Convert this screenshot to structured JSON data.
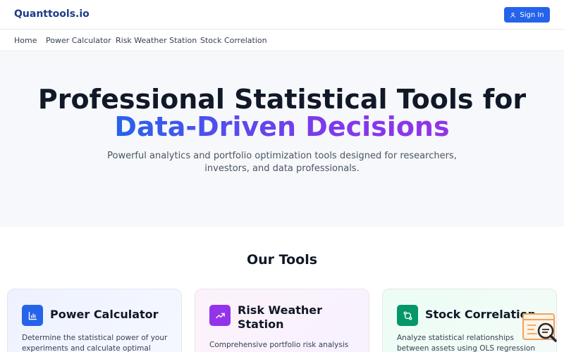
{
  "header": {
    "brand": "Quanttools.io",
    "signin_label": "Sign In",
    "accent_color": "#2563eb"
  },
  "nav": {
    "items": [
      "Home",
      "Power Calculator",
      "Risk Weather Station",
      "Stock Correlation"
    ]
  },
  "hero": {
    "title_line1": "Professional Statistical Tools for",
    "title_line2": "Data-Driven Decisions",
    "subtitle": "Powerful analytics and portfolio optimization tools designed for researchers, investors, and data professionals."
  },
  "tools": {
    "heading": "Our Tools",
    "cards": [
      {
        "title": "Power Calculator",
        "description": "Determine the statistical power of your experiments and calculate optimal",
        "icon": "bar-chart-icon",
        "color": "#2563eb"
      },
      {
        "title": "Risk Weather Station",
        "description": "Comprehensive portfolio risk analysis",
        "icon": "trending-up-icon",
        "color": "#9333ea"
      },
      {
        "title": "Stock Correlation",
        "description": "Analyze statistical relationships between assets using OLS regression and Engle-",
        "icon": "git-compare-icon",
        "color": "#059669"
      }
    ]
  }
}
